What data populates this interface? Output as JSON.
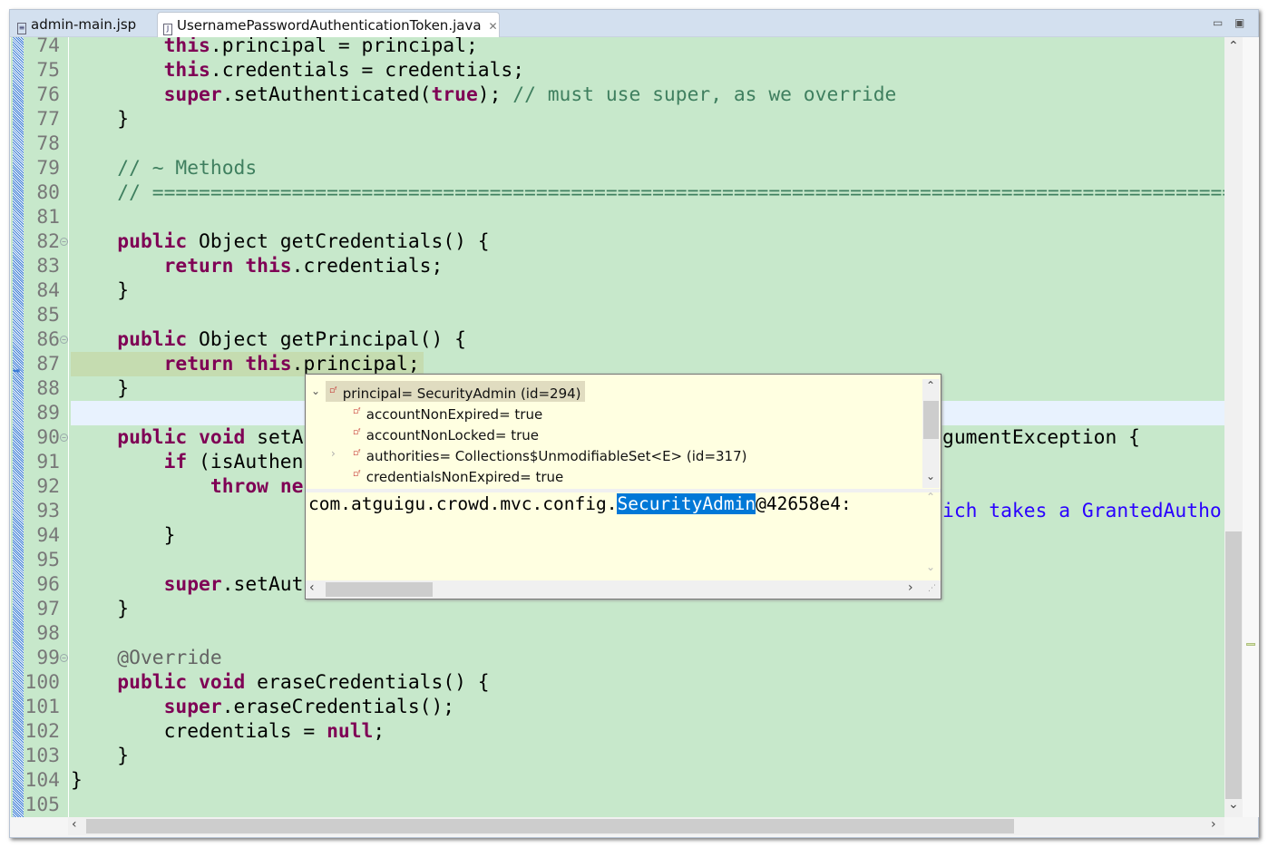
{
  "tabs": [
    {
      "label": "admin-main.jsp",
      "icon": "jsp-file-icon",
      "active": false
    },
    {
      "label": "UsernamePasswordAuthenticationToken.java",
      "icon": "java-file-icon",
      "active": true
    }
  ],
  "window_buttons": {
    "minimize": "minimize-icon",
    "maximize": "maximize-icon"
  },
  "colors": {
    "editor_bg": "#c7e8cb",
    "keyword": "#7f0055",
    "comment": "#3f7f5f",
    "string": "#2a00ff",
    "selection": "#0078d7",
    "hover_bg": "#ffffe1"
  },
  "lines": [
    {
      "n": "74",
      "t": [
        [
          "",
          "        "
        ],
        [
          "k",
          "this"
        ],
        [
          "",
          ".principal = principal;"
        ]
      ]
    },
    {
      "n": "75",
      "t": [
        [
          "",
          "        "
        ],
        [
          "k",
          "this"
        ],
        [
          "",
          ".credentials = credentials;"
        ]
      ]
    },
    {
      "n": "76",
      "t": [
        [
          "",
          "        "
        ],
        [
          "k",
          "super"
        ],
        [
          "",
          ".setAuthenticated("
        ],
        [
          "k",
          "true"
        ],
        [
          "",
          "); "
        ],
        [
          "c",
          "// must use super, as we override"
        ]
      ]
    },
    {
      "n": "77",
      "t": [
        [
          "",
          "    }"
        ]
      ]
    },
    {
      "n": "78",
      "t": []
    },
    {
      "n": "79",
      "t": [
        [
          "",
          "    "
        ],
        [
          "c",
          "// ~ Methods"
        ]
      ]
    },
    {
      "n": "80",
      "t": [
        [
          "",
          "    "
        ],
        [
          "c",
          "// ========================================================================================================"
        ]
      ]
    },
    {
      "n": "81",
      "t": []
    },
    {
      "n": "82",
      "fold": true,
      "t": [
        [
          "",
          "    "
        ],
        [
          "k",
          "public"
        ],
        [
          "",
          " Object getCredentials() {"
        ]
      ]
    },
    {
      "n": "83",
      "t": [
        [
          "",
          "        "
        ],
        [
          "k",
          "return"
        ],
        [
          "",
          " "
        ],
        [
          "k",
          "this"
        ],
        [
          "",
          ".credentials;"
        ]
      ]
    },
    {
      "n": "84",
      "t": [
        [
          "",
          "    }"
        ]
      ]
    },
    {
      "n": "85",
      "t": []
    },
    {
      "n": "86",
      "fold": true,
      "t": [
        [
          "",
          "    "
        ],
        [
          "k",
          "public"
        ],
        [
          "",
          " Object getPrincipal() {"
        ]
      ]
    },
    {
      "n": "87",
      "t": [
        [
          "",
          "        "
        ],
        [
          "k",
          "return"
        ],
        [
          "",
          " "
        ],
        [
          "k",
          "this"
        ],
        [
          "",
          ".principal;"
        ]
      ]
    },
    {
      "n": "88",
      "t": [
        [
          "",
          "    }"
        ]
      ]
    },
    {
      "n": "89",
      "t": []
    },
    {
      "n": "90",
      "fold": true,
      "t": [
        [
          "",
          "    "
        ],
        [
          "k",
          "public"
        ],
        [
          "",
          " "
        ],
        [
          "k",
          "void"
        ],
        [
          "",
          " setA"
        ]
      ],
      "r": [
        [
          "",
          "gumentException {"
        ]
      ]
    },
    {
      "n": "91",
      "t": [
        [
          "",
          "        "
        ],
        [
          "k",
          "if"
        ],
        [
          "",
          " (isAuthen"
        ]
      ]
    },
    {
      "n": "92",
      "t": [
        [
          "",
          "            "
        ],
        [
          "k",
          "throw"
        ],
        [
          "",
          " "
        ],
        [
          "k",
          "ne"
        ]
      ]
    },
    {
      "n": "93",
      "t": [],
      "r": [
        [
          "s",
          "ich takes a GrantedAutho"
        ]
      ]
    },
    {
      "n": "94",
      "t": [
        [
          "",
          "        }"
        ]
      ]
    },
    {
      "n": "95",
      "t": []
    },
    {
      "n": "96",
      "t": [
        [
          "",
          "        "
        ],
        [
          "k",
          "super"
        ],
        [
          "",
          ".setAut"
        ]
      ]
    },
    {
      "n": "97",
      "t": [
        [
          "",
          "    }"
        ]
      ]
    },
    {
      "n": "98",
      "t": []
    },
    {
      "n": "99",
      "fold": true,
      "t": [
        [
          "",
          "    "
        ],
        [
          "a",
          "@Override"
        ]
      ]
    },
    {
      "n": "100",
      "t": [
        [
          "",
          "    "
        ],
        [
          "k",
          "public"
        ],
        [
          "",
          " "
        ],
        [
          "k",
          "void"
        ],
        [
          "",
          " eraseCredentials() {"
        ]
      ]
    },
    {
      "n": "101",
      "t": [
        [
          "",
          "        "
        ],
        [
          "k",
          "super"
        ],
        [
          "",
          ".eraseCredentials();"
        ]
      ]
    },
    {
      "n": "102",
      "t": [
        [
          "",
          "        credentials = "
        ],
        [
          "k",
          "null"
        ],
        [
          "",
          ";"
        ]
      ]
    },
    {
      "n": "103",
      "t": [
        [
          "",
          "    }"
        ]
      ]
    },
    {
      "n": "104",
      "t": [
        [
          "",
          "}"
        ]
      ]
    },
    {
      "n": "105",
      "t": []
    }
  ],
  "debug_popup": {
    "tree": [
      {
        "label": "principal= SecurityAdmin  (id=294)",
        "expanded": true,
        "selected": true,
        "level": 0
      },
      {
        "label": "accountNonExpired= true",
        "level": 1
      },
      {
        "label": "accountNonLocked= true",
        "level": 1
      },
      {
        "label": "authorities= Collections$UnmodifiableSet<E>  (id=317)",
        "level": 1,
        "expandable": true
      },
      {
        "label": "credentialsNonExpired= true",
        "level": 1
      }
    ],
    "detail_prefix": "com.atguigu.crowd.mvc.config.",
    "detail_selected": "SecurityAdmin",
    "detail_suffix": "@42658e4:"
  }
}
